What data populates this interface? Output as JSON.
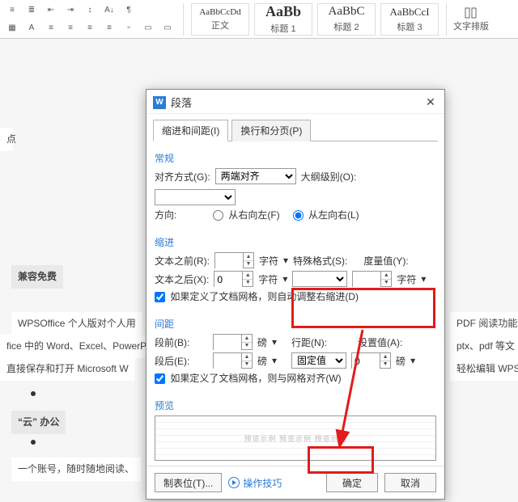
{
  "ribbon": {
    "styles": [
      {
        "sample": "AaBbCcDd",
        "sample_size": "11px",
        "label": "正文"
      },
      {
        "sample": "AaBb",
        "sample_size": "18px",
        "label": "标题 1"
      },
      {
        "sample": "AaBbC",
        "sample_size": "15px",
        "label": "标题 2"
      },
      {
        "sample": "AaBbCcI",
        "sample_size": "13px",
        "label": "标题 3"
      }
    ],
    "right_label": "文字排版"
  },
  "doc": {
    "h1": "兼容免费",
    "p1": "WPSOffice 个人版对个人用",
    "p2": "fice 中的 Word、Excel、PowerP",
    "p3": "直接保存和打开  Microsoft W",
    "h2": "“云” 办公",
    "p4": "一个账号，随时随地阅读、",
    "r1": "PDF 阅读功能",
    "r2": "ptx、pdf 等文",
    "r3": "轻松编辑 WPS",
    "left_hint": "点"
  },
  "dialog": {
    "title": "段落",
    "tabs": {
      "indent": "缩进和间距(I)",
      "pagination": "换行和分页(P)"
    },
    "section_general": "常规",
    "align_label": "对齐方式(G):",
    "align_value": "两端对齐",
    "outline_label": "大纲级别(O):",
    "outline_value": "",
    "direction_label": "方向:",
    "dir_rtl": "从右向左(F)",
    "dir_ltr": "从左向右(L)",
    "section_indent": "缩进",
    "indent_before_label": "文本之前(R):",
    "indent_before_value": "",
    "chars_unit": "字符",
    "special_label": "特殊格式(S):",
    "special_value": "",
    "by_label": "度量值(Y):",
    "by_value": "",
    "indent_after_label": "文本之后(X):",
    "indent_after_value": "0",
    "auto_indent_grid": "如果定义了文档网格，则自动调整右缩进(D)",
    "section_spacing": "间距",
    "space_before_label": "段前(B):",
    "space_before_value": "",
    "space_after_label": "段后(E):",
    "space_after_value": "",
    "pound_unit": "磅",
    "line_spacing_label": "行距(N):",
    "line_spacing_value": "固定值",
    "set_value_label": "设置值(A):",
    "set_value_value": "0",
    "snap_grid": "如果定义了文档网格，则与网格对齐(W)",
    "section_preview": "预览",
    "tabstops": "制表位(T)...",
    "tips": "操作技巧",
    "ok": "确定",
    "cancel": "取消"
  }
}
